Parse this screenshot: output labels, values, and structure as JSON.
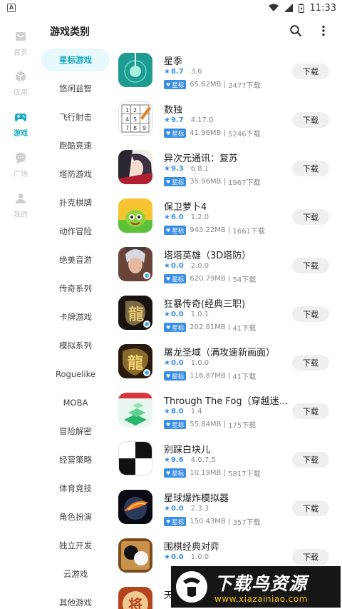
{
  "status": {
    "time": "11:33",
    "left_icon": "A"
  },
  "nav": [
    {
      "label": "首页",
      "icon": "mail-icon",
      "active": false
    },
    {
      "label": "应用",
      "icon": "cube-icon",
      "active": false
    },
    {
      "label": "游戏",
      "icon": "gamepad-icon",
      "active": true
    },
    {
      "label": "广场",
      "icon": "chat-icon",
      "active": false
    },
    {
      "label": "我的",
      "icon": "person-icon",
      "active": false
    }
  ],
  "header": {
    "title": "游戏类别"
  },
  "categories": [
    "星标游戏",
    "悠闲益智",
    "飞行射击",
    "跑酷竞速",
    "塔防游戏",
    "扑克棋牌",
    "动作冒险",
    "绝美音游",
    "传奇系列",
    "卡牌游戏",
    "模拟系列",
    "Roguelike",
    "MOBA",
    "冒险解密",
    "经营策略",
    "体育竞技",
    "角色扮演",
    "独立开发",
    "云游戏",
    "其他游戏"
  ],
  "active_category": 0,
  "badge_label": "星标",
  "download_label": "下载",
  "apps": [
    {
      "name": "星季",
      "rating": "8.7",
      "version": "3.6",
      "size": "65.62MB",
      "downloads": "3477下载",
      "icon": "teal-orb-icon"
    },
    {
      "name": "数独",
      "rating": "9.7",
      "version": "4.17.0",
      "size": "41.96MB",
      "downloads": "5246下载",
      "icon": "sudoku-grid-icon"
    },
    {
      "name": "异次元通讯：复苏",
      "rating": "9.3",
      "version": "6.8.1",
      "size": "35.96MB",
      "downloads": "1967下载",
      "icon": "anime-girl-icon"
    },
    {
      "name": "保卫萝卜4",
      "rating": "6.0",
      "version": "1.2.0",
      "size": "943.22MB",
      "downloads": "1661下载",
      "icon": "carrot-icon"
    },
    {
      "name": "塔塔英雄（3D塔防）",
      "rating": "0.0",
      "version": "2.0.0",
      "size": "620.79MB",
      "downloads": "54下载",
      "icon": "hero-portrait-icon"
    },
    {
      "name": "狂暴传奇(经典三职)",
      "rating": "0.0",
      "version": "1.0.1",
      "size": "202.81MB",
      "downloads": "41下载",
      "icon": "dragon-emblem-icon"
    },
    {
      "name": "屠龙圣域（满攻速新画面）",
      "rating": "0.0",
      "version": "1.0.0",
      "size": "116.87MB",
      "downloads": "41下载",
      "icon": "dragon-gold-icon"
    },
    {
      "name": "Through The Fog（穿越迷雾...",
      "rating": "8.0",
      "version": "1.4",
      "size": "55.84MB",
      "downloads": "175下载",
      "icon": "green-tiles-icon"
    },
    {
      "name": "别踩白块儿",
      "rating": "9.6",
      "version": "4.0.7.5",
      "size": "10.19MB",
      "downloads": "5817下载",
      "icon": "piano-tiles-icon"
    },
    {
      "name": "星球爆炸模拟器",
      "rating": "0.0",
      "version": "2.3.3",
      "size": "150.43MB",
      "downloads": "357下载",
      "icon": "planet-explosion-icon"
    },
    {
      "name": "围棋经典对弈",
      "rating": "0.0",
      "version": "1.0.0",
      "size": "",
      "downloads": "",
      "icon": "go-board-icon"
    },
    {
      "name": "天",
      "rating": "",
      "version": "",
      "size": "",
      "downloads": "",
      "icon": "chess-piece-icon"
    }
  ],
  "watermark": {
    "title": "下载鸟资源",
    "url": "www.xiazainiao.com"
  }
}
